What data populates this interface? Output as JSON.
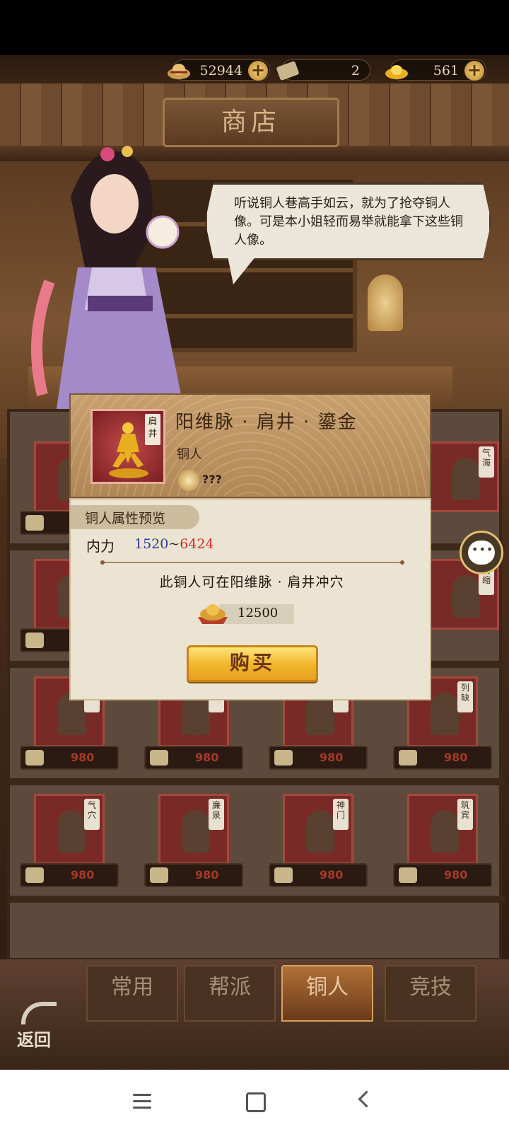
{
  "currency": {
    "silver": "52944",
    "ticket": "2",
    "gold": "561"
  },
  "title": "商店",
  "npc_speech": "听说铜人巷高手如云，就为了抢夺铜人像。可是本小姐轻而易举就能拿下这些铜人像。",
  "popup": {
    "item_name": "阳维脉 · 肩井 · 鎏金",
    "item_tag": "肩井",
    "item_type": "铜人",
    "requirement": "???",
    "section_title": "铜人属性预览",
    "attr_label": "内力",
    "attr_min": "1520",
    "attr_sep": "~",
    "attr_max": "6424",
    "description": "此铜人可在阳维脉 · 肩井冲穴",
    "price": "12500",
    "buy_label": "购买"
  },
  "grid": {
    "tags": [
      "气海",
      "筋缩",
      "阙",
      "神",
      "谷",
      "列缺",
      "气穴",
      "廉泉",
      "神门",
      "筑宾"
    ],
    "price_label": "980"
  },
  "tabs": [
    {
      "label": "常用",
      "active": false
    },
    {
      "label": "帮派",
      "active": false
    },
    {
      "label": "铜人",
      "active": true
    },
    {
      "label": "竞技",
      "active": false
    }
  ],
  "back_label": "返回",
  "colors": {
    "accent_gold": "#f0b52a",
    "attr_min": "#2a3c9a",
    "attr_max": "#d02a2a"
  }
}
